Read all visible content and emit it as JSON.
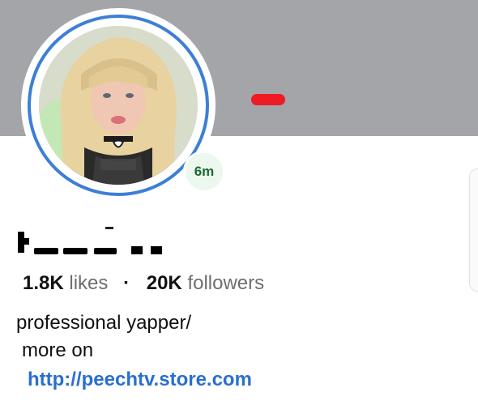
{
  "profile": {
    "story_badge": "6m",
    "stats": {
      "likes_count": "1.8K",
      "likes_label": "likes",
      "separator": "·",
      "followers_count": "20K",
      "followers_label": "followers"
    },
    "bio": {
      "line1": "professional yapper/",
      "line2": "more on",
      "link": "http://peechtv.store.com"
    }
  },
  "colors": {
    "cover": "#a3a5a9",
    "story_ring": "#3d7fd6",
    "link": "#2a6fcf",
    "badge_bg": "#ecf8ee",
    "badge_text": "#1d6b34",
    "red_mark": "#ee1b24"
  }
}
